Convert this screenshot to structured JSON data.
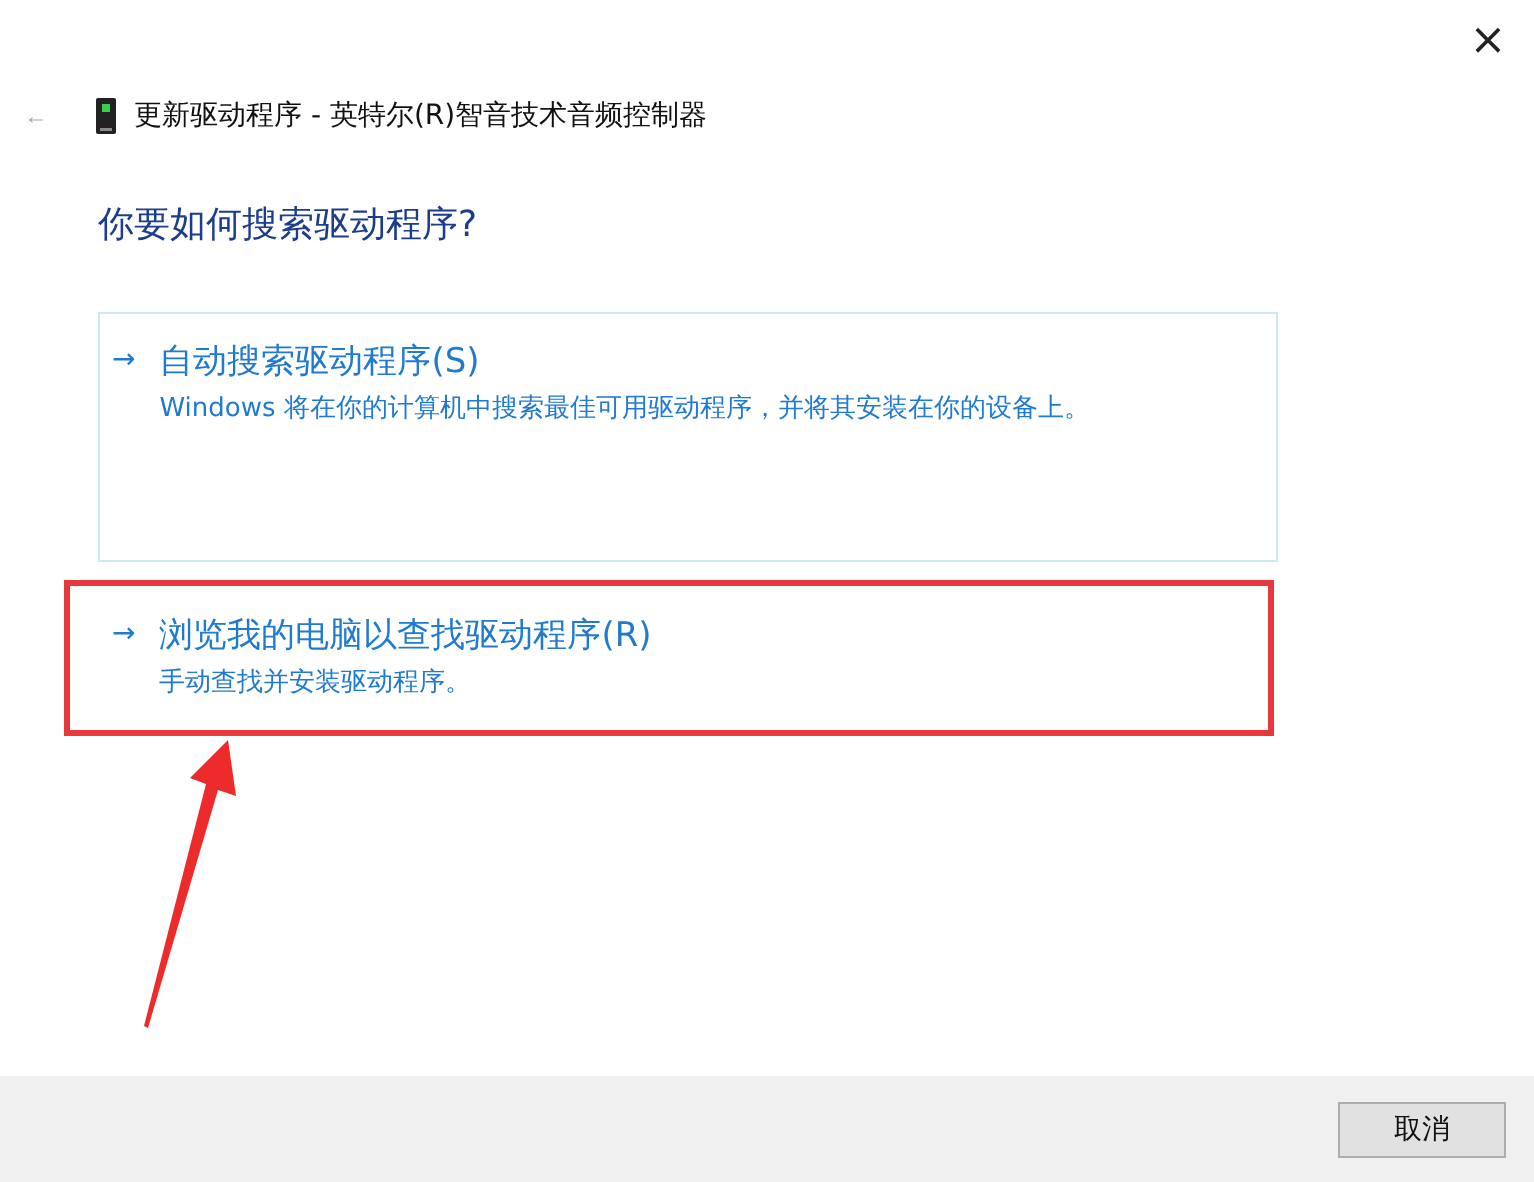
{
  "window": {
    "title": "更新驱动程序 - 英特尔(R)智音技术音频控制器",
    "close": "×",
    "back": "←"
  },
  "heading": "你要如何搜索驱动程序?",
  "options": [
    {
      "arrow": "→",
      "title": "自动搜索驱动程序(S)",
      "description": "Windows 将在你的计算机中搜索最佳可用驱动程序，并将其安装在你的设备上。",
      "focused": true,
      "highlighted": false
    },
    {
      "arrow": "→",
      "title": "浏览我的电脑以查找驱动程序(R)",
      "description": "手动查找并安装驱动程序。",
      "focused": false,
      "highlighted": true
    }
  ],
  "buttons": [
    {
      "label": "取消"
    }
  ]
}
